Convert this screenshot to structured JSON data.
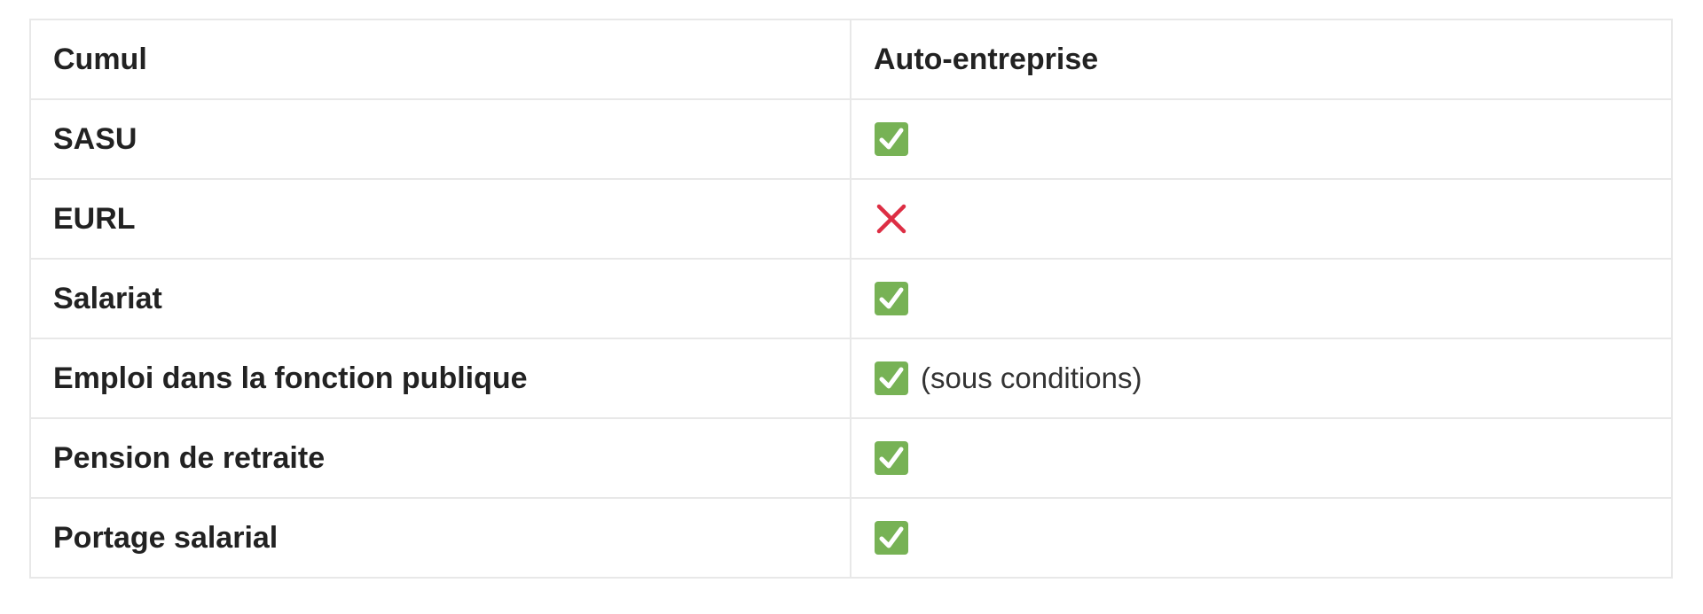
{
  "table": {
    "headers": [
      "Cumul",
      "Auto-entreprise"
    ],
    "rows": [
      {
        "label": "SASU",
        "status": "yes",
        "icon": "check-icon",
        "note": ""
      },
      {
        "label": "EURL",
        "status": "no",
        "icon": "cross-icon",
        "note": ""
      },
      {
        "label": "Salariat",
        "status": "yes",
        "icon": "check-icon",
        "note": ""
      },
      {
        "label": "Emploi dans la fonction publique",
        "status": "yes",
        "icon": "check-icon",
        "note": "(sous conditions)"
      },
      {
        "label": "Pension de retraite",
        "status": "yes",
        "icon": "check-icon",
        "note": ""
      },
      {
        "label": "Portage salarial",
        "status": "yes",
        "icon": "check-icon",
        "note": ""
      }
    ]
  },
  "colors": {
    "check_background": "#77b255",
    "check_mark": "#ffffff",
    "cross": "#dd2e44",
    "border": "#e8e8e8"
  }
}
